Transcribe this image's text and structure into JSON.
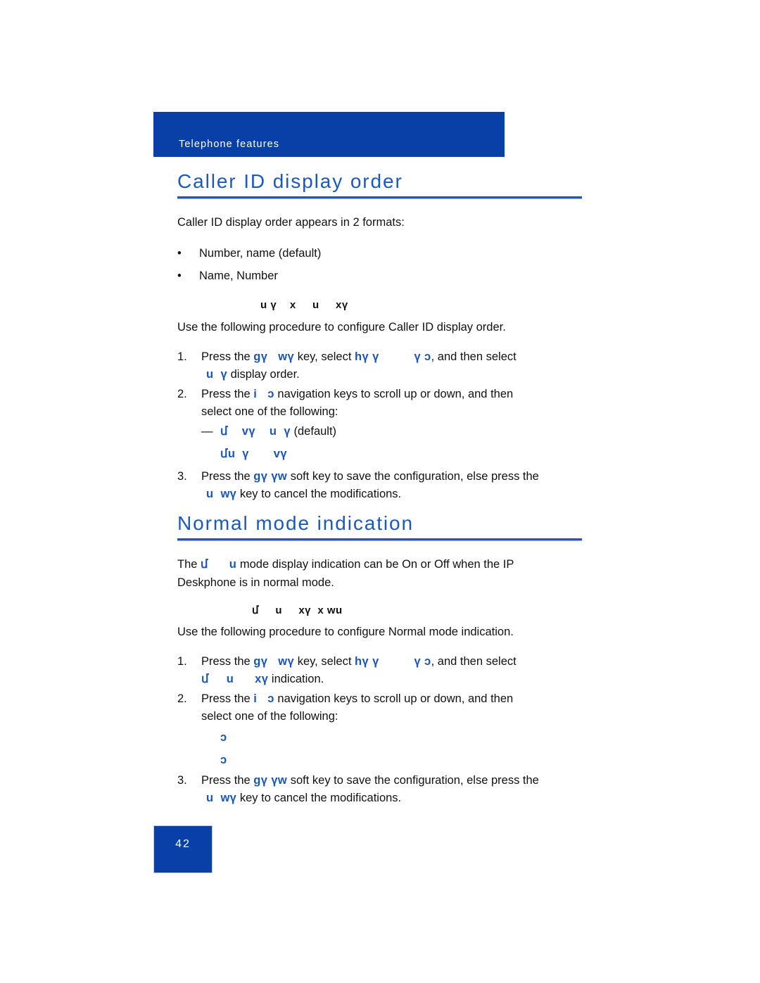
{
  "document": {
    "running_header": "Telephone features",
    "page_number": "42",
    "accent_blue": "#0840a8",
    "heading_blue": "#1a5ac0",
    "ui_term_blue": "#1a54bd"
  },
  "sections": [
    {
      "heading": "Caller ID display order",
      "intro": "Caller ID display order appears in 2 formats:",
      "bullets": [
        {
          "mark": "•",
          "text": "Number, name (default)"
        },
        {
          "mark": "•",
          "text": "Name, Number"
        }
      ],
      "figure_caption": "u ү    x     u     xү",
      "procedure_intro": "Use the following procedure to configure Caller ID display order.",
      "steps": [
        {
          "num": "1.",
          "line1_a": "Press the ",
          "line1_term1": "ɡү   wү",
          "line1_b": " key, select ",
          "line1_term2": "hү ү          ү ɔ",
          "line1_c": ", and then select",
          "line2_term": "u  ү",
          "line2_text": " display order."
        },
        {
          "num": "2.",
          "line1_a": "Press the ",
          "line1_term1": "i   ɔ",
          "line1_b": "      navigation keys to scroll up or down, and then",
          "line2_text": "select one of the following:"
        },
        {
          "num": "3.",
          "line1_a": "Press the ",
          "line1_term1": "ɡү үw",
          "line1_b": " soft key to save the configuration, else press the",
          "line2_term": "u  wү",
          "line2_text": " key to cancel the modifications."
        }
      ],
      "substeps": [
        {
          "dash": "—",
          "term": "մ    vү    u  ү",
          "tail": " (default)"
        },
        {
          "dash": "",
          "term": "մu  ү       vү",
          "tail": ""
        }
      ]
    },
    {
      "heading": "Normal mode indication",
      "intro_a": "The ",
      "intro_term": "մ      u",
      "intro_b": " mode display indication can be On or Off when the IP",
      "intro_line2": "Deskphone is in normal mode.",
      "figure_caption": "մ     u     xү  x wu",
      "procedure_intro": "Use the following procedure to configure Normal mode indication.",
      "steps": [
        {
          "num": "1.",
          "line1_a": "Press the ",
          "line1_term1": "ɡү   wү",
          "line1_b": " key, select ",
          "line1_term2": "hү ү          ү ɔ",
          "line1_c": ", and then select",
          "line2_term": "մ     u      xү",
          "line2_text": " indication."
        },
        {
          "num": "2.",
          "line1_a": "Press the ",
          "line1_term1": "i   ɔ",
          "line1_b": "      navigation keys to scroll up or down, and then",
          "line2_text": "select one of the following:"
        },
        {
          "num": "3.",
          "line1_a": "Press the ",
          "line1_term1": "ɡү үw",
          "line1_b": " soft key to save the configuration, else press the",
          "line2_term": "u  wү",
          "line2_text": " key to cancel the modifications."
        }
      ],
      "substeps": [
        {
          "dash": "",
          "term": "ɔ",
          "tail": ""
        },
        {
          "dash": "",
          "term": "ɔ",
          "tail": ""
        }
      ]
    }
  ]
}
